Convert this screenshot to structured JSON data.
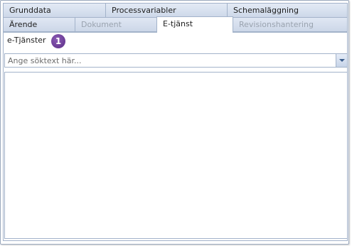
{
  "tabs": {
    "row1": [
      {
        "label": "Grunddata"
      },
      {
        "label": "Processvariabler"
      },
      {
        "label": "Schemaläggning"
      }
    ],
    "row2": [
      {
        "label": "Ärende",
        "state": "enabled"
      },
      {
        "label": "Dokument",
        "state": "disabled"
      },
      {
        "label": "E-tjänst",
        "state": "active"
      },
      {
        "label": "Revisionshantering",
        "state": "disabled"
      }
    ]
  },
  "panel": {
    "section_label": "e-Tjänster",
    "badge": "1",
    "search": {
      "placeholder": "Ange söktext här...",
      "value": ""
    },
    "list_items": []
  },
  "colors": {
    "accent_badge": "#5b2d86",
    "tab_border": "#a3b3ca",
    "tab_bg": "#d6e0ef"
  }
}
